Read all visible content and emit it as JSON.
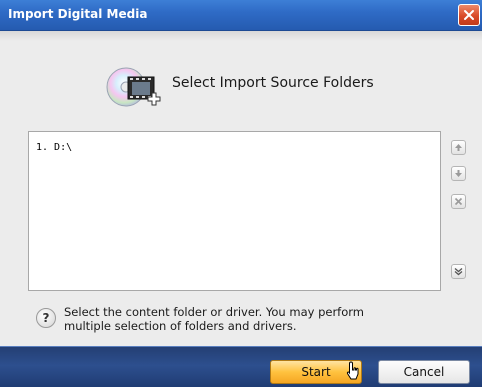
{
  "window": {
    "title": "Import Digital Media"
  },
  "header": {
    "heading": "Select Import Source Folders",
    "icon": "cd-film-add-icon"
  },
  "folder_list": {
    "items": [
      {
        "label": "1. D:\\"
      }
    ]
  },
  "side_buttons": [
    "move-up-icon",
    "move-down-icon",
    "remove-icon",
    "expand-down-icon"
  ],
  "help": {
    "icon_glyph": "?",
    "line1": "Select the content folder or driver. You may perform",
    "line2": "multiple selection of folders and drivers."
  },
  "footer": {
    "start_label": "Start",
    "cancel_label": "Cancel"
  },
  "colors": {
    "title_bar": "#2f6bc6",
    "start_button": "#ffc23f",
    "footer": "#2d4f8e"
  }
}
